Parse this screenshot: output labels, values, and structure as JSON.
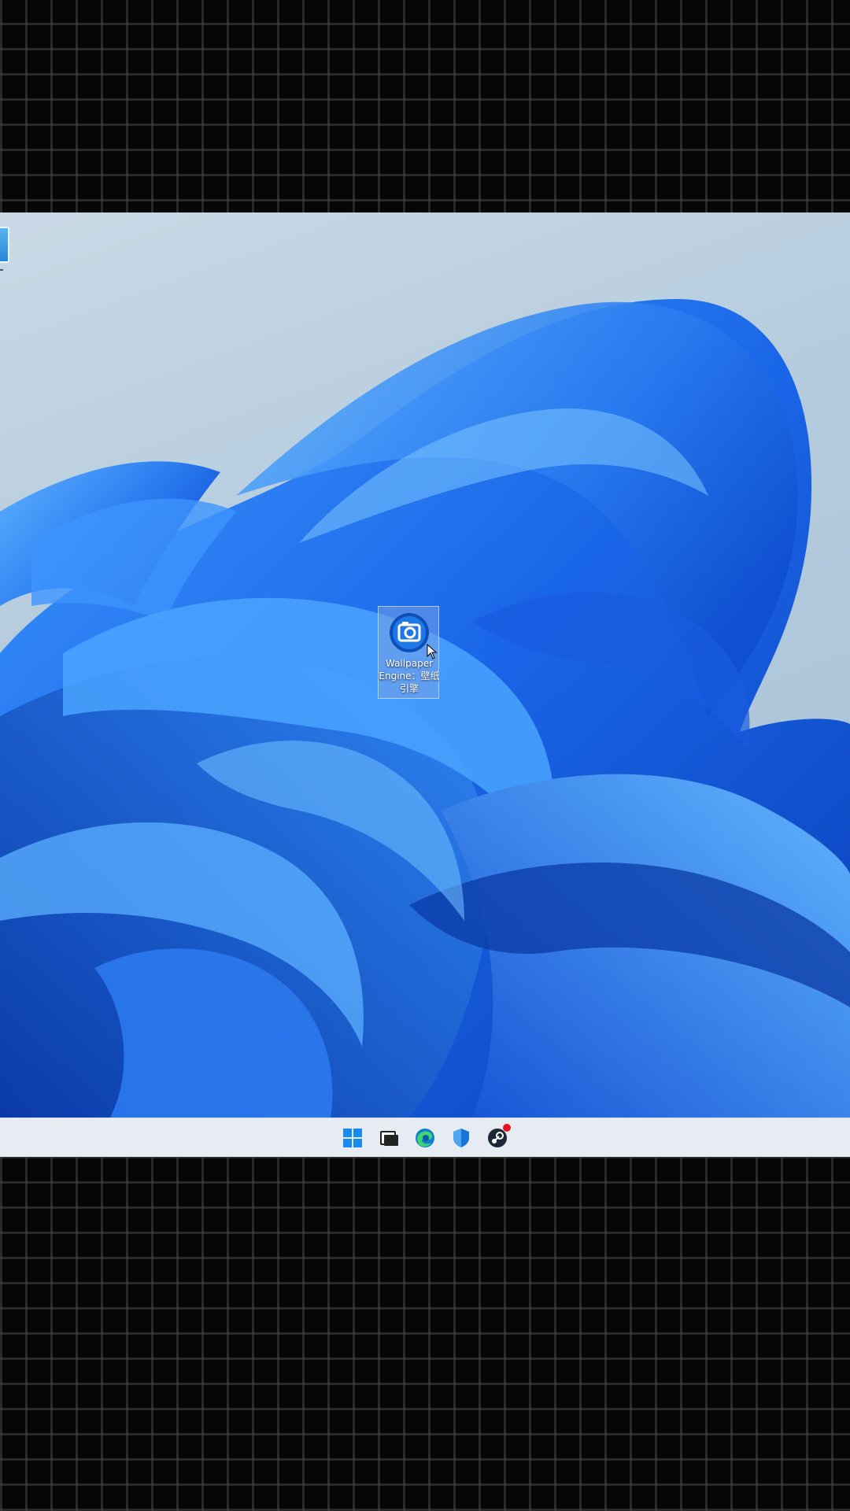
{
  "desktop": {
    "icons": [
      {
        "label": "Wallpaper Engine：壁纸引擎",
        "icon": "wallpaper-engine-icon"
      }
    ],
    "edge_icon": "partially-visible-icon"
  },
  "taskbar": {
    "items": [
      {
        "name": "Start",
        "icon": "windows-logo-icon"
      },
      {
        "name": "Task View",
        "icon": "task-view-icon"
      },
      {
        "name": "Microsoft Edge",
        "icon": "edge-icon"
      },
      {
        "name": "Windows Security",
        "icon": "shield-icon"
      },
      {
        "name": "Steam",
        "icon": "steam-icon",
        "badge": true
      }
    ]
  },
  "colors": {
    "wallpaper_blue": "#1e6fe6",
    "taskbar_bg": "#e6ecf2",
    "accent": "#0078d4",
    "badge_red": "#e81123"
  }
}
